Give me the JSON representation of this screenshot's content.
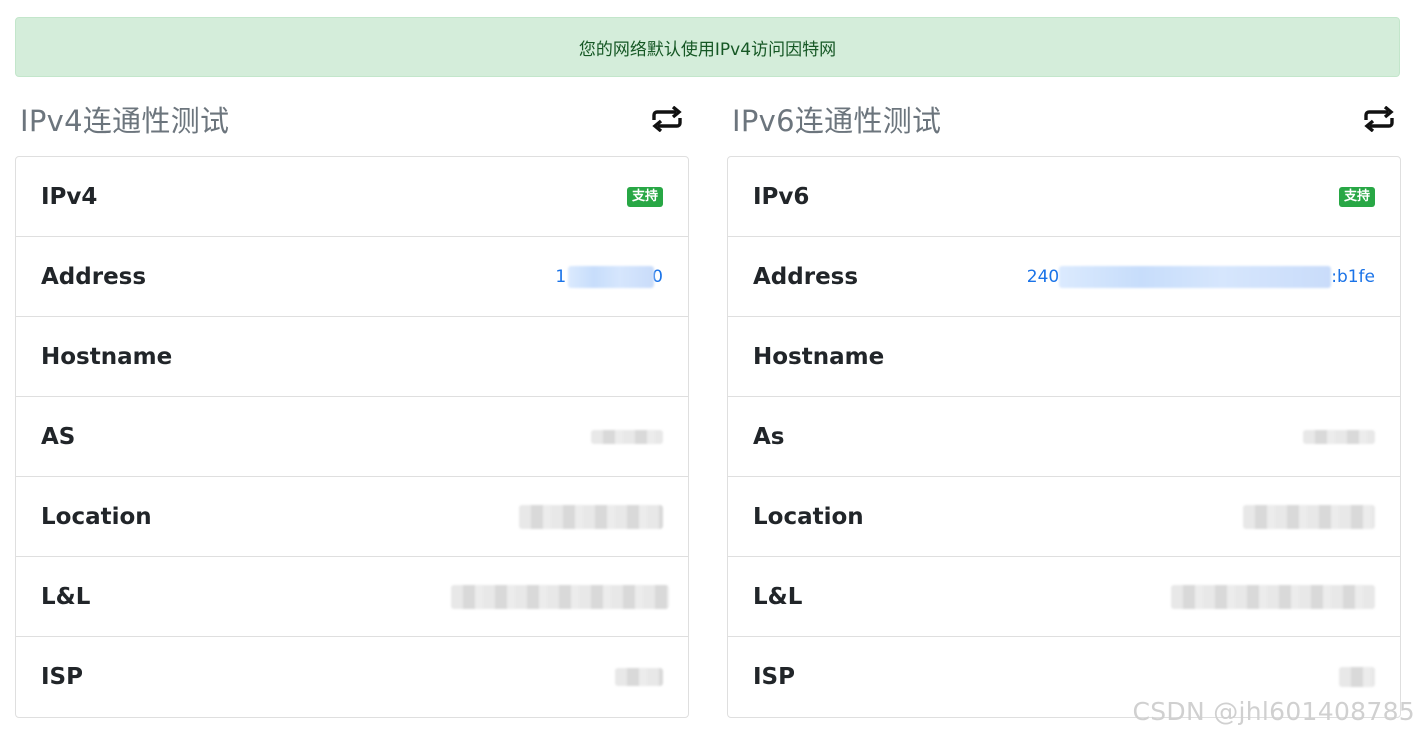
{
  "banner": {
    "text": "您的网络默认使用IPv4访问因特网"
  },
  "ipv4": {
    "title": "IPv4连通性测试",
    "refresh_icon": "refresh-icon",
    "rows": [
      {
        "label": "IPv4",
        "badge": "支持"
      },
      {
        "label": "Address",
        "value_prefix": "1",
        "value_suffix": "0"
      },
      {
        "label": "Hostname"
      },
      {
        "label": "AS"
      },
      {
        "label": "Location"
      },
      {
        "label": "L&L"
      },
      {
        "label": "ISP"
      }
    ]
  },
  "ipv6": {
    "title": "IPv6连通性测试",
    "refresh_icon": "refresh-icon",
    "rows": [
      {
        "label": "IPv6",
        "badge": "支持"
      },
      {
        "label": "Address",
        "value_prefix": "240",
        "value_suffix": ":b1fe"
      },
      {
        "label": "Hostname"
      },
      {
        "label": "As"
      },
      {
        "label": "Location"
      },
      {
        "label": "L&L"
      },
      {
        "label": "ISP"
      }
    ]
  },
  "watermark": "CSDN @jhl601408785",
  "colors": {
    "success_badge": "#28a745",
    "link": "#1a73e8",
    "banner_bg": "#d4edda",
    "banner_text": "#155724"
  }
}
